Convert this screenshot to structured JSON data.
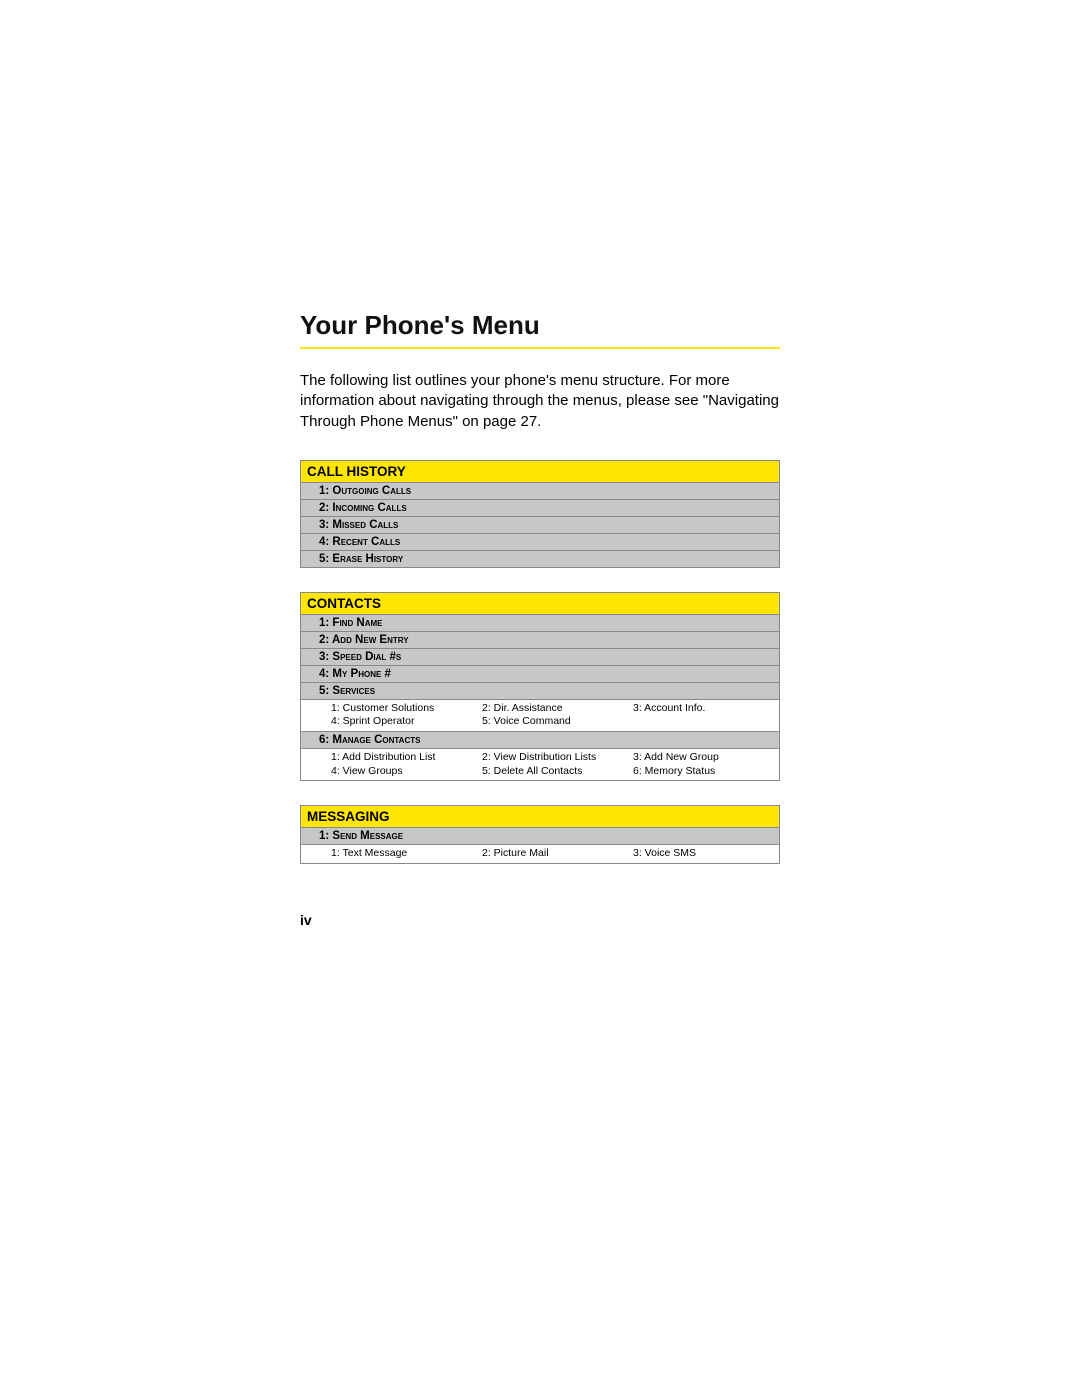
{
  "title": "Your Phone's Menu",
  "intro": "The following list outlines your phone's menu structure. For more information about navigating through the menus, please see \"Navigating Through Phone Menus\" on page 27.",
  "sections": {
    "call_history": {
      "header": "Call History",
      "items": [
        "1: Outgoing Calls",
        "2: Incoming Calls",
        "3: Missed Calls",
        "4: Recent Calls",
        "5: Erase History"
      ]
    },
    "contacts": {
      "header": "Contacts",
      "items": [
        "1: Find Name",
        "2: Add New Entry",
        "3: Speed Dial #s",
        "4: My Phone #",
        "5: Services"
      ],
      "services_sub": [
        "1: Customer Solutions",
        "2: Dir. Assistance",
        "3: Account Info.",
        "4: Sprint Operator",
        "5: Voice Command",
        ""
      ],
      "manage_label": "6: Manage Contacts",
      "manage_sub": [
        "1: Add Distribution List",
        "2: View Distribution Lists",
        "3: Add New Group",
        "4: View Groups",
        "5: Delete All Contacts",
        "6: Memory Status"
      ]
    },
    "messaging": {
      "header": "Messaging",
      "items": [
        "1: Send Message"
      ],
      "send_sub": [
        "1: Text Message",
        "2: Picture Mail",
        "3: Voice SMS"
      ]
    }
  },
  "page_number": "iv"
}
